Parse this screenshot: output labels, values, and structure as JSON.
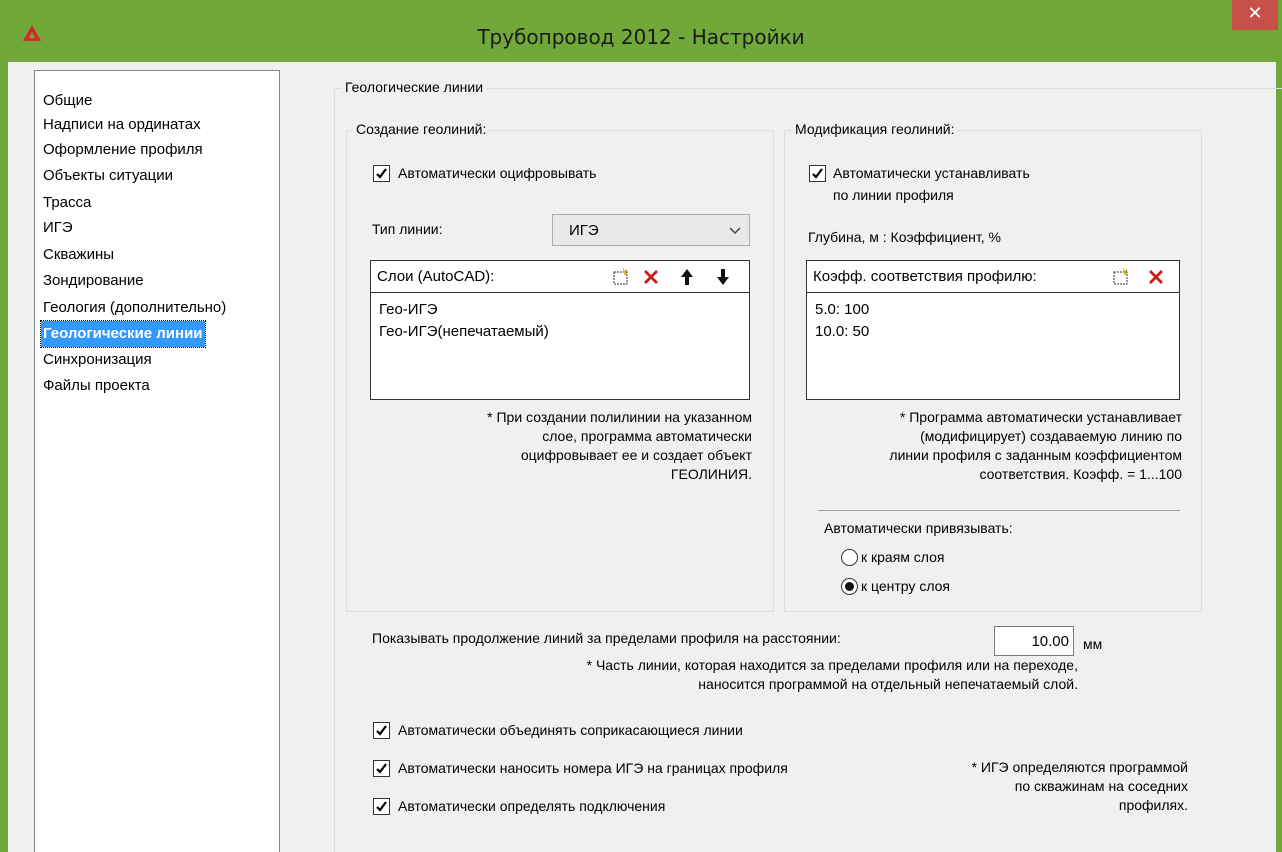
{
  "window": {
    "title": "Трубопровод 2012 - Настройки",
    "close_symbol": "✕",
    "accent_color": "#70a83a",
    "close_color": "#c7504a",
    "selected_color": "#3399ff"
  },
  "nav": {
    "items": [
      "Общие",
      "Надписи на ординатах",
      "Оформление профиля",
      "Объекты ситуации",
      "Трасса",
      "ИГЭ",
      "Скважины",
      "Зондирование",
      "Геология (дополнительно)",
      "Геологические линии",
      "Синхронизация",
      "Файлы проекта"
    ],
    "selected_index": 9
  },
  "main": {
    "group_title": "Геологические линии",
    "create": {
      "group_title": "Создание геолиний:",
      "auto_digitize_label": "Автоматически оцифровывать",
      "auto_digitize_checked": true,
      "line_type_label": "Тип линии:",
      "line_type_value": "ИГЭ",
      "layers_header": "Слои (AutoCAD):",
      "layers": [
        "Гео-ИГЭ",
        "Гео-ИГЭ(непечатаемый)"
      ],
      "note_lines": [
        "* При создании полилинии на указанном",
        "слое, программа автоматически",
        "оцифровывает ее и создает объект",
        "ГЕОЛИНИЯ."
      ]
    },
    "modify": {
      "group_title": "Модификация геолиний:",
      "auto_set_label_1": "Автоматически устанавливать",
      "auto_set_label_2": "по линии профиля",
      "auto_set_checked": true,
      "depth_label": "Глубина, м : Коэффициент, %",
      "coef_header": "Коэфф. соответствия профилю:",
      "coefs": [
        "5.0: 100",
        "10.0: 50"
      ],
      "note_lines": [
        "* Программа автоматически устанавливает",
        "(модифицирует) создаваемую линию по",
        "линии профиля с заданным коэффициентом",
        "соответствия. Коэфф. = 1...100"
      ],
      "snap_label": "Автоматически привязывать:",
      "snap_options": [
        "к краям слоя",
        "к центру слоя"
      ],
      "snap_selected": 1
    },
    "extension": {
      "label": "Показывать продолжение линий за пределами профиля на расстоянии:",
      "value": "10.00",
      "unit": "мм",
      "note_lines": [
        "* Часть линии, которая находится за пределами профиля или на переходе,",
        "наносится программой на отдельный непечатаемый слой."
      ]
    },
    "options": {
      "merge_label": "Автоматически объединять соприкасающиеся линии",
      "merge_checked": true,
      "ige_numbers_label": "Автоматически наносить номера ИГЭ на границах профиля",
      "ige_numbers_checked": true,
      "connections_label": "Автоматически определять подключения",
      "connections_checked": true,
      "ige_note_lines": [
        "* ИГЭ определяются программой",
        "по скважинам на соседних",
        "профилях."
      ]
    }
  }
}
